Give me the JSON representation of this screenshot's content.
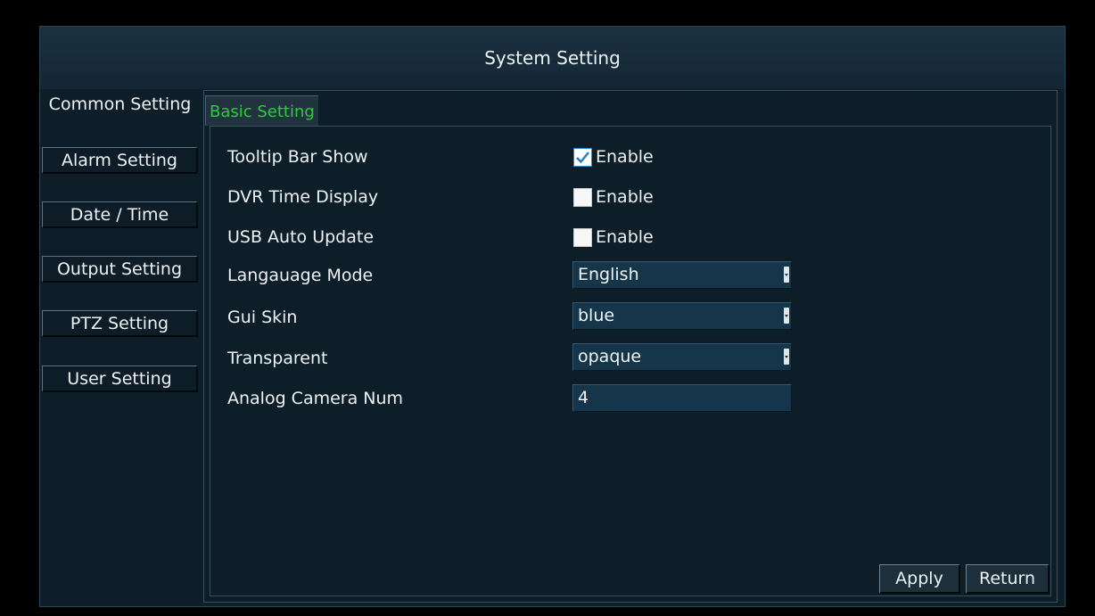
{
  "window": {
    "title": "System Setting"
  },
  "sidebar": {
    "items": [
      {
        "label": "Common Setting",
        "active": true
      },
      {
        "label": "Alarm Setting"
      },
      {
        "label": "Date / Time"
      },
      {
        "label": "Output Setting"
      },
      {
        "label": "PTZ Setting"
      },
      {
        "label": "User Setting"
      }
    ]
  },
  "tab": {
    "label": "Basic Setting",
    "color": "#2ccc3a"
  },
  "settings": {
    "tooltip_bar": {
      "label": "Tooltip Bar Show",
      "option": "Enable",
      "checked": true
    },
    "dvr_time": {
      "label": "DVR Time Display",
      "option": "Enable",
      "checked": false
    },
    "usb_update": {
      "label": "USB Auto Update",
      "option": "Enable",
      "checked": false
    },
    "language": {
      "label": "Langauage Mode",
      "value": "English"
    },
    "gui_skin": {
      "label": "Gui Skin",
      "value": "blue"
    },
    "transparent": {
      "label": "Transparent",
      "value": "opaque"
    },
    "camera_num": {
      "label": "Analog Camera Num",
      "value": "4"
    }
  },
  "buttons": {
    "apply": "Apply",
    "return": "Return"
  },
  "icons": {
    "checkmark": "check-icon",
    "dropdown": "dropdown-arrow-icon"
  }
}
